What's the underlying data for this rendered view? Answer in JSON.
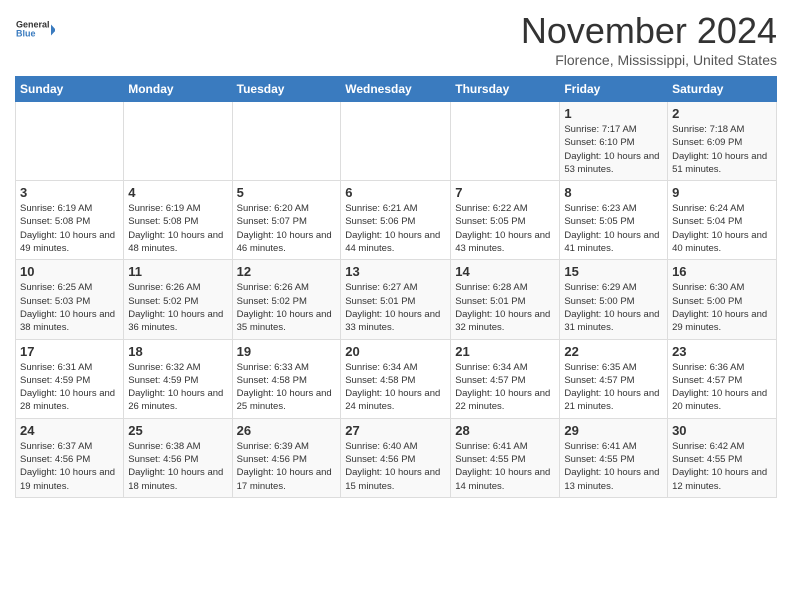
{
  "logo": {
    "general": "General",
    "blue": "Blue"
  },
  "title": "November 2024",
  "location": "Florence, Mississippi, United States",
  "headers": [
    "Sunday",
    "Monday",
    "Tuesday",
    "Wednesday",
    "Thursday",
    "Friday",
    "Saturday"
  ],
  "weeks": [
    [
      {
        "day": "",
        "info": ""
      },
      {
        "day": "",
        "info": ""
      },
      {
        "day": "",
        "info": ""
      },
      {
        "day": "",
        "info": ""
      },
      {
        "day": "",
        "info": ""
      },
      {
        "day": "1",
        "info": "Sunrise: 7:17 AM\nSunset: 6:10 PM\nDaylight: 10 hours and 53 minutes."
      },
      {
        "day": "2",
        "info": "Sunrise: 7:18 AM\nSunset: 6:09 PM\nDaylight: 10 hours and 51 minutes."
      }
    ],
    [
      {
        "day": "3",
        "info": "Sunrise: 6:19 AM\nSunset: 5:08 PM\nDaylight: 10 hours and 49 minutes."
      },
      {
        "day": "4",
        "info": "Sunrise: 6:19 AM\nSunset: 5:08 PM\nDaylight: 10 hours and 48 minutes."
      },
      {
        "day": "5",
        "info": "Sunrise: 6:20 AM\nSunset: 5:07 PM\nDaylight: 10 hours and 46 minutes."
      },
      {
        "day": "6",
        "info": "Sunrise: 6:21 AM\nSunset: 5:06 PM\nDaylight: 10 hours and 44 minutes."
      },
      {
        "day": "7",
        "info": "Sunrise: 6:22 AM\nSunset: 5:05 PM\nDaylight: 10 hours and 43 minutes."
      },
      {
        "day": "8",
        "info": "Sunrise: 6:23 AM\nSunset: 5:05 PM\nDaylight: 10 hours and 41 minutes."
      },
      {
        "day": "9",
        "info": "Sunrise: 6:24 AM\nSunset: 5:04 PM\nDaylight: 10 hours and 40 minutes."
      }
    ],
    [
      {
        "day": "10",
        "info": "Sunrise: 6:25 AM\nSunset: 5:03 PM\nDaylight: 10 hours and 38 minutes."
      },
      {
        "day": "11",
        "info": "Sunrise: 6:26 AM\nSunset: 5:02 PM\nDaylight: 10 hours and 36 minutes."
      },
      {
        "day": "12",
        "info": "Sunrise: 6:26 AM\nSunset: 5:02 PM\nDaylight: 10 hours and 35 minutes."
      },
      {
        "day": "13",
        "info": "Sunrise: 6:27 AM\nSunset: 5:01 PM\nDaylight: 10 hours and 33 minutes."
      },
      {
        "day": "14",
        "info": "Sunrise: 6:28 AM\nSunset: 5:01 PM\nDaylight: 10 hours and 32 minutes."
      },
      {
        "day": "15",
        "info": "Sunrise: 6:29 AM\nSunset: 5:00 PM\nDaylight: 10 hours and 31 minutes."
      },
      {
        "day": "16",
        "info": "Sunrise: 6:30 AM\nSunset: 5:00 PM\nDaylight: 10 hours and 29 minutes."
      }
    ],
    [
      {
        "day": "17",
        "info": "Sunrise: 6:31 AM\nSunset: 4:59 PM\nDaylight: 10 hours and 28 minutes."
      },
      {
        "day": "18",
        "info": "Sunrise: 6:32 AM\nSunset: 4:59 PM\nDaylight: 10 hours and 26 minutes."
      },
      {
        "day": "19",
        "info": "Sunrise: 6:33 AM\nSunset: 4:58 PM\nDaylight: 10 hours and 25 minutes."
      },
      {
        "day": "20",
        "info": "Sunrise: 6:34 AM\nSunset: 4:58 PM\nDaylight: 10 hours and 24 minutes."
      },
      {
        "day": "21",
        "info": "Sunrise: 6:34 AM\nSunset: 4:57 PM\nDaylight: 10 hours and 22 minutes."
      },
      {
        "day": "22",
        "info": "Sunrise: 6:35 AM\nSunset: 4:57 PM\nDaylight: 10 hours and 21 minutes."
      },
      {
        "day": "23",
        "info": "Sunrise: 6:36 AM\nSunset: 4:57 PM\nDaylight: 10 hours and 20 minutes."
      }
    ],
    [
      {
        "day": "24",
        "info": "Sunrise: 6:37 AM\nSunset: 4:56 PM\nDaylight: 10 hours and 19 minutes."
      },
      {
        "day": "25",
        "info": "Sunrise: 6:38 AM\nSunset: 4:56 PM\nDaylight: 10 hours and 18 minutes."
      },
      {
        "day": "26",
        "info": "Sunrise: 6:39 AM\nSunset: 4:56 PM\nDaylight: 10 hours and 17 minutes."
      },
      {
        "day": "27",
        "info": "Sunrise: 6:40 AM\nSunset: 4:56 PM\nDaylight: 10 hours and 15 minutes."
      },
      {
        "day": "28",
        "info": "Sunrise: 6:41 AM\nSunset: 4:55 PM\nDaylight: 10 hours and 14 minutes."
      },
      {
        "day": "29",
        "info": "Sunrise: 6:41 AM\nSunset: 4:55 PM\nDaylight: 10 hours and 13 minutes."
      },
      {
        "day": "30",
        "info": "Sunrise: 6:42 AM\nSunset: 4:55 PM\nDaylight: 10 hours and 12 minutes."
      }
    ]
  ]
}
